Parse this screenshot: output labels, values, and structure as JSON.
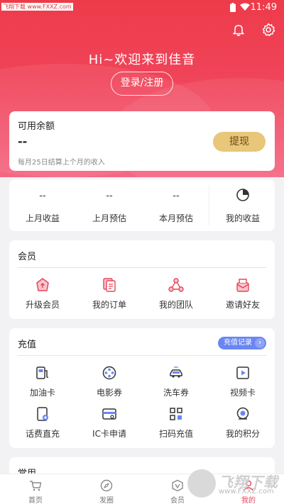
{
  "status": {
    "time": "11:49",
    "watermark": "飞翔下载 www.FXXZ.com"
  },
  "header": {
    "welcome": "Hi~欢迎来到佳音",
    "login_label": "登录/注册"
  },
  "balance": {
    "title": "可用余额",
    "value": "--",
    "withdraw_label": "提现",
    "note": "每月25日结算上个月的收入"
  },
  "income": {
    "items": [
      {
        "value": "--",
        "label": "上月收益"
      },
      {
        "value": "--",
        "label": "上月预估"
      },
      {
        "value": "--",
        "label": "本月预估"
      }
    ],
    "my_income_label": "我的收益"
  },
  "member": {
    "title": "会员",
    "items": [
      {
        "label": "升级会员",
        "icon": "upgrade-icon"
      },
      {
        "label": "我的订单",
        "icon": "orders-icon"
      },
      {
        "label": "我的团队",
        "icon": "team-icon"
      },
      {
        "label": "邀请好友",
        "icon": "invite-icon"
      }
    ]
  },
  "recharge": {
    "title": "充值",
    "records_label": "充值记录",
    "items": [
      {
        "label": "加油卡",
        "icon": "fuel-icon"
      },
      {
        "label": "电影券",
        "icon": "film-reel-icon"
      },
      {
        "label": "洗车券",
        "icon": "car-wash-icon"
      },
      {
        "label": "视频卡",
        "icon": "video-play-icon"
      },
      {
        "label": "话费直充",
        "icon": "phone-icon"
      },
      {
        "label": "IC卡申请",
        "icon": "card-icon"
      },
      {
        "label": "扫码充值",
        "icon": "qr-code-icon"
      },
      {
        "label": "我的积分",
        "icon": "points-icon"
      }
    ]
  },
  "common": {
    "title": "常用"
  },
  "tabbar": {
    "items": [
      {
        "label": "首页",
        "icon": "cart-icon"
      },
      {
        "label": "发圈",
        "icon": "compass-icon"
      },
      {
        "label": "会员",
        "icon": "vip-icon"
      },
      {
        "label": "我的",
        "icon": "user-icon"
      }
    ]
  },
  "watermark_br": {
    "text": "飞翔下载",
    "url": "www.FXXZ.com"
  },
  "colors": {
    "header_top": "#ee3b4a",
    "header_bottom": "#f56783",
    "withdraw_bg": "#e8c67a",
    "records_bg": "#6a86f2",
    "icon_red": "#e8445a"
  }
}
